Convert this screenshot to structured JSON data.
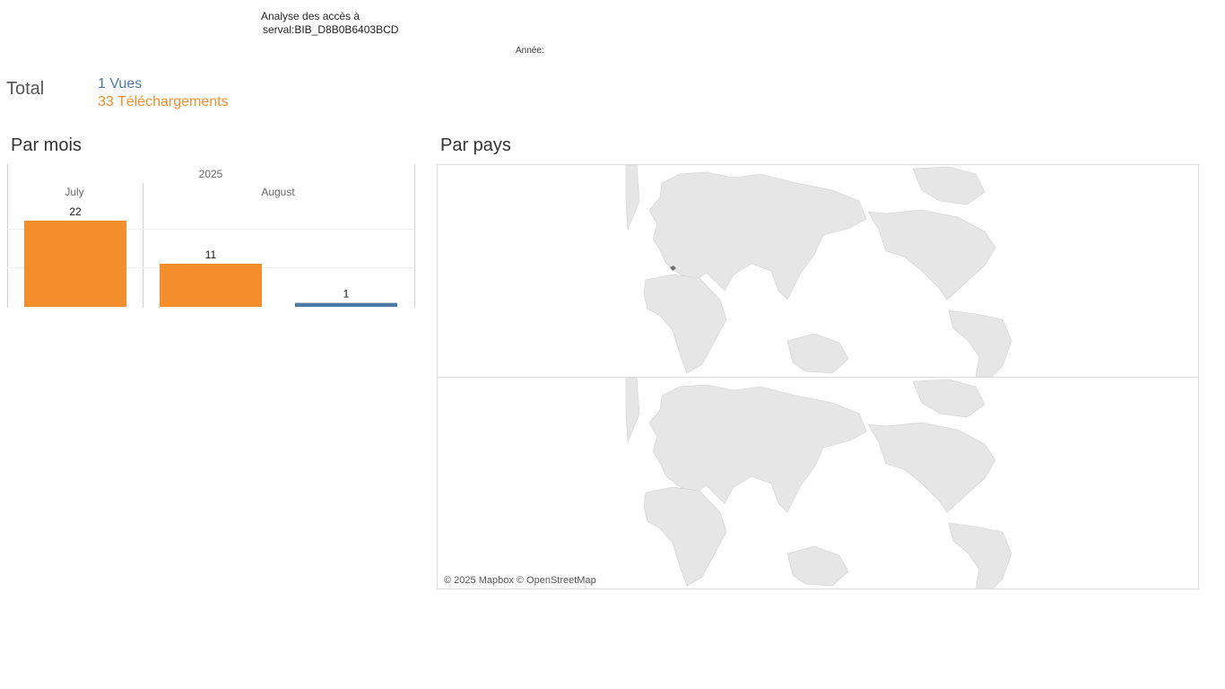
{
  "header": {
    "title_line1": "Analyse des accès à",
    "title_line2": "serval:BIB_D8B0B6403BCD",
    "year_filter_label": "Année:"
  },
  "totals": {
    "label": "Total",
    "vues": "1 Vues",
    "telechargements": "33 Téléchargements"
  },
  "sections": {
    "par_mois": "Par mois",
    "par_pays": "Par pays"
  },
  "colors": {
    "vues": "#4e79a7",
    "telechargements": "#f28e2b"
  },
  "chart_data": {
    "type": "bar",
    "year": "2025",
    "categories": [
      "July",
      "August"
    ],
    "bars": [
      {
        "month": "July",
        "series": "Téléchargements",
        "value": 22,
        "label": "22"
      },
      {
        "month": "August",
        "series": "Téléchargements",
        "value": 11,
        "label": "11"
      },
      {
        "month": "August",
        "series": "Vues",
        "value": 1,
        "label": "1"
      }
    ],
    "ylim": [
      0,
      22
    ],
    "grid": true
  },
  "map": {
    "credit": "© 2025 Mapbox © OpenStreetMap"
  }
}
